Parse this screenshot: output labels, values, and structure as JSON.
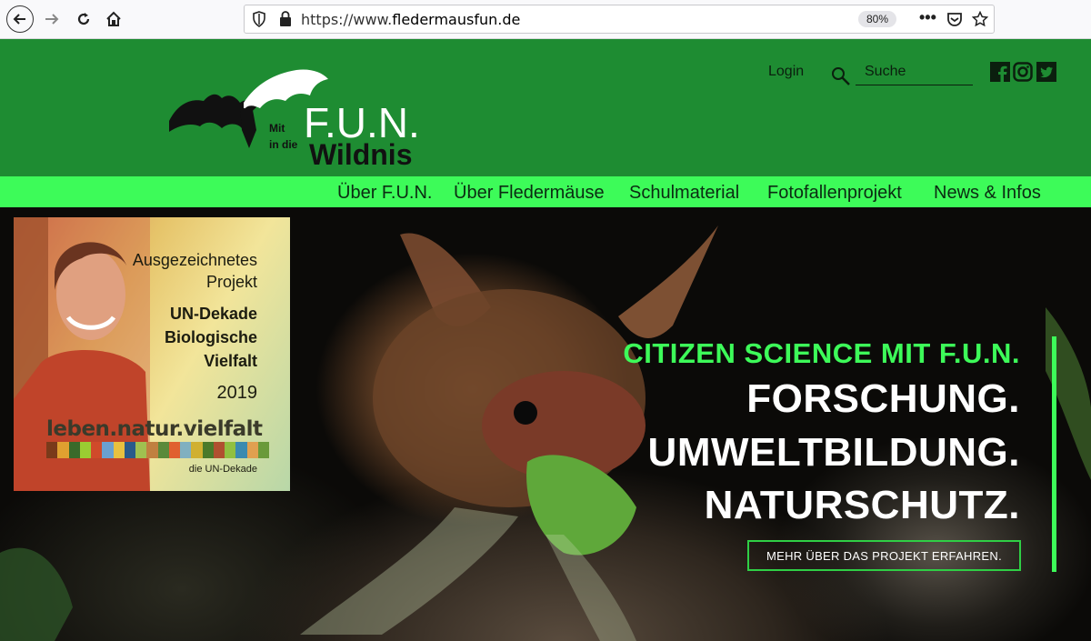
{
  "browser": {
    "url_prefix": "https://www.",
    "url_domain": "fledermausfun.de",
    "zoom": "80%"
  },
  "site": {
    "logo": {
      "mit": "Mit",
      "in_die": "in die",
      "fun": "F.U.N.",
      "wildnis": "Wildnis"
    },
    "login_label": "Login",
    "search_placeholder": "Suche",
    "nav": [
      "Über F.U.N.",
      "Über Fledermäuse",
      "Schulmaterial",
      "Fotofallenprojekt",
      "News & Infos"
    ]
  },
  "award": {
    "line1": "Ausgezeichnetes",
    "line2": "Projekt",
    "line3": "UN-Dekade",
    "line4": "Biologische",
    "line5": "Vielfalt",
    "year": "2019",
    "brand": "leben.natur.vielfalt",
    "sub": "die UN-Dekade"
  },
  "hero": {
    "tagline": "CITIZEN SCIENCE MIT F.U.N.",
    "line1": "FORSCHUNG.",
    "line2": "UMWELTBILDUNG.",
    "line3": "NATURSCHUTZ.",
    "cta": "MEHR ÜBER DAS PROJEKT ERFAHREN."
  },
  "colors": {
    "header_green": "#1e8c32",
    "nav_green": "#3dfb59",
    "accent": "#3dfb59"
  }
}
